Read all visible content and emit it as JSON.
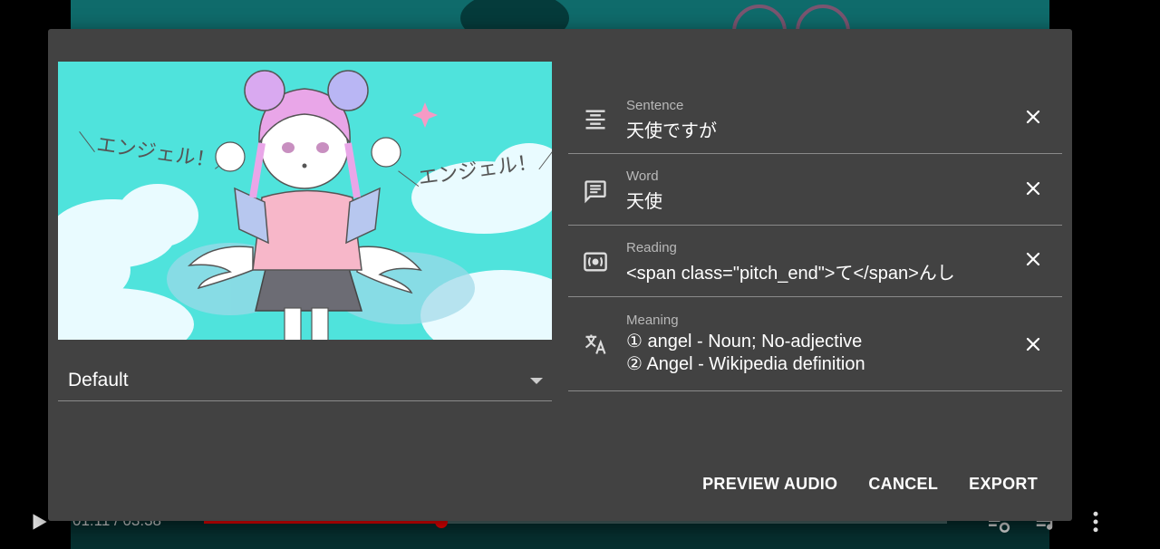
{
  "player": {
    "time": "01:11 / 03:38",
    "progress": 0.32
  },
  "dialog": {
    "track": {
      "selected": "Default"
    },
    "fields": [
      {
        "label": "Sentence",
        "value": "天使ですが",
        "icon": "align-center-icon"
      },
      {
        "label": "Word",
        "value": "天使",
        "icon": "chat-text-icon"
      },
      {
        "label": "Reading",
        "value": "<span class=\"pitch_end\">て</span>んし",
        "icon": "audio-box-icon"
      },
      {
        "label": "Meaning",
        "value_lines": [
          "① angel - Noun;  No-adjective",
          "② Angel - Wikipedia definition"
        ],
        "icon": "translate-icon"
      }
    ],
    "actions": {
      "preview": "PREVIEW AUDIO",
      "cancel": "CANCEL",
      "export": "EXPORT"
    },
    "thumbnail": {
      "caption_left": "＼エンジェル！／",
      "caption_right": "＼エンジェル！／"
    }
  },
  "colors": {
    "dialog_bg": "#424242",
    "accent_red": "#ff0000",
    "thumb_bg": "#4fe3dc"
  }
}
